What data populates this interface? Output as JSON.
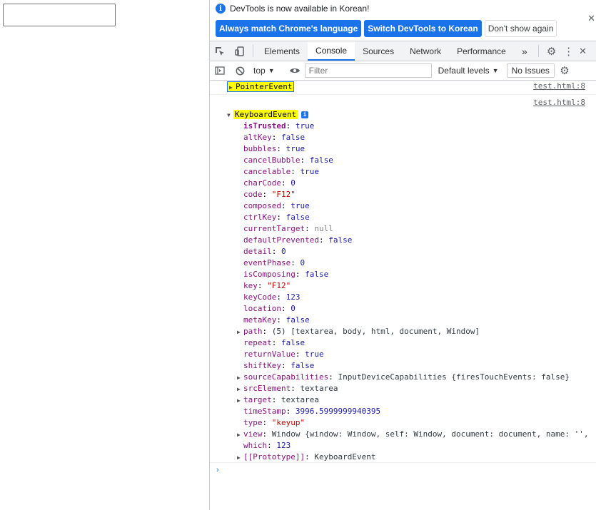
{
  "infobar": {
    "message": "DevTools is now available in Korean!",
    "match_button": "Always match Chrome's language",
    "switch_button": "Switch DevTools to Korean",
    "dismiss_button": "Don't show again"
  },
  "tabs": [
    "Elements",
    "Console",
    "Sources",
    "Network",
    "Performance"
  ],
  "more_tabs": "»",
  "toolbar": {
    "context": "top",
    "filter_placeholder": "Filter",
    "levels": "Default levels",
    "issues": "No Issues"
  },
  "console": {
    "pointer_event": "PointerEvent",
    "pointer_source": "test.html:8",
    "keyboard_source": "test.html:8",
    "keyboard_event": "KeyboardEvent",
    "props": [
      {
        "key": "isTrusted",
        "value": "true",
        "type": "bool",
        "own": true
      },
      {
        "key": "altKey",
        "value": "false",
        "type": "bool"
      },
      {
        "key": "bubbles",
        "value": "true",
        "type": "bool"
      },
      {
        "key": "cancelBubble",
        "value": "false",
        "type": "bool"
      },
      {
        "key": "cancelable",
        "value": "true",
        "type": "bool"
      },
      {
        "key": "charCode",
        "value": "0",
        "type": "num"
      },
      {
        "key": "code",
        "value": "\"F12\"",
        "type": "str"
      },
      {
        "key": "composed",
        "value": "true",
        "type": "bool"
      },
      {
        "key": "ctrlKey",
        "value": "false",
        "type": "bool"
      },
      {
        "key": "currentTarget",
        "value": "null",
        "type": "null"
      },
      {
        "key": "defaultPrevented",
        "value": "false",
        "type": "bool"
      },
      {
        "key": "detail",
        "value": "0",
        "type": "num"
      },
      {
        "key": "eventPhase",
        "value": "0",
        "type": "num"
      },
      {
        "key": "isComposing",
        "value": "false",
        "type": "bool"
      },
      {
        "key": "key",
        "value": "\"F12\"",
        "type": "str"
      },
      {
        "key": "keyCode",
        "value": "123",
        "type": "num"
      },
      {
        "key": "location",
        "value": "0",
        "type": "num"
      },
      {
        "key": "metaKey",
        "value": "false",
        "type": "bool"
      },
      {
        "key": "path",
        "value": "(5) [textarea, body, html, document, Window]",
        "type": "obj",
        "expandable": true
      },
      {
        "key": "repeat",
        "value": "false",
        "type": "bool"
      },
      {
        "key": "returnValue",
        "value": "true",
        "type": "bool"
      },
      {
        "key": "shiftKey",
        "value": "false",
        "type": "bool"
      },
      {
        "key": "sourceCapabilities",
        "value": "InputDeviceCapabilities {firesTouchEvents: false}",
        "type": "obj",
        "expandable": true
      },
      {
        "key": "srcElement",
        "value": "textarea",
        "type": "obj",
        "expandable": true
      },
      {
        "key": "target",
        "value": "textarea",
        "type": "obj",
        "expandable": true
      },
      {
        "key": "timeStamp",
        "value": "3996.5999999940395",
        "type": "num"
      },
      {
        "key": "type",
        "value": "\"keyup\"",
        "type": "str"
      },
      {
        "key": "view",
        "value": "Window {window: Window, self: Window, document: document, name: '',",
        "type": "obj",
        "expandable": true
      },
      {
        "key": "which",
        "value": "123",
        "type": "num"
      },
      {
        "key": "[[Prototype]]",
        "value": "KeyboardEvent",
        "type": "obj",
        "expandable": true
      }
    ]
  }
}
